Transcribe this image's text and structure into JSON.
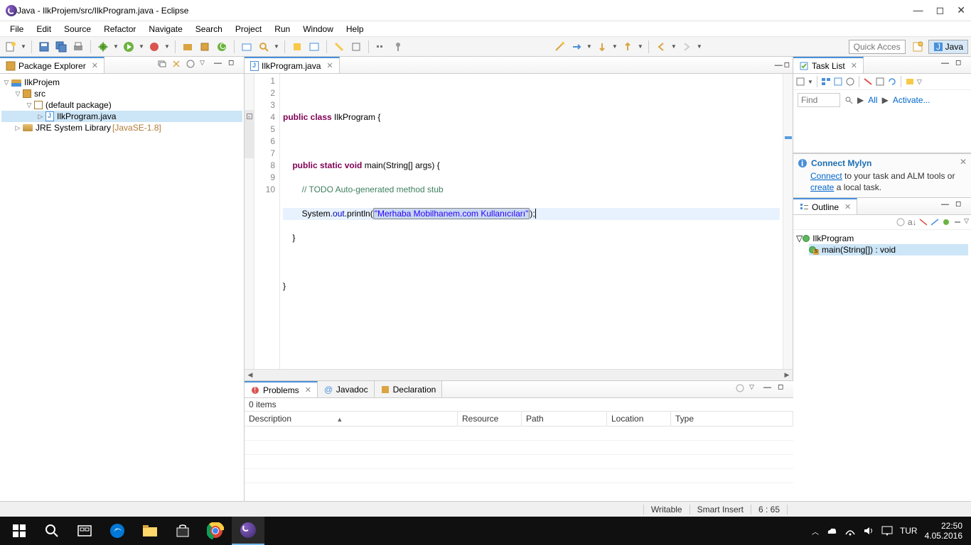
{
  "window": {
    "title": "Java - IlkProjem/src/IlkProgram.java - Eclipse"
  },
  "menu": [
    "File",
    "Edit",
    "Source",
    "Refactor",
    "Navigate",
    "Search",
    "Project",
    "Run",
    "Window",
    "Help"
  ],
  "quick_access": {
    "placeholder": "Quick Access"
  },
  "perspective": {
    "label": "Java"
  },
  "package_explorer": {
    "title": "Package Explorer",
    "project": "IlkProjem",
    "src": "src",
    "default_pkg": "(default package)",
    "file": "IlkProgram.java",
    "jre_label": "JRE System Library",
    "jre_version": "[JavaSE-1.8]"
  },
  "editor": {
    "tab": "IlkProgram.java",
    "lines": [
      "1",
      "2",
      "3",
      "4",
      "5",
      "6",
      "7",
      "8",
      "9",
      "10"
    ],
    "code": {
      "class_decl_pre": "public class ",
      "class_name": "IlkProgram",
      "method_pre": "public static void ",
      "method_name": "main",
      "method_args": "(String[] args) {",
      "comment": "// TODO Auto-generated method stub",
      "print_pre": "System.",
      "print_field": "out",
      "print_method": ".println(",
      "print_str": "\"Merhaba Mobilhanem.com Kullanıcıları\"",
      "print_end": ");"
    }
  },
  "problems": {
    "tabs": [
      "Problems",
      "Javadoc",
      "Declaration"
    ],
    "count": "0 items",
    "columns": [
      "Description",
      "Resource",
      "Path",
      "Location",
      "Type"
    ]
  },
  "task_list": {
    "title": "Task List",
    "find_label": "Find",
    "all_label": "All",
    "activate_label": "Activate..."
  },
  "mylyn": {
    "title": "Connect Mylyn",
    "link1": "Connect",
    "text1": " to your task and ALM tools or ",
    "link2": "create",
    "text2": " a local task."
  },
  "outline": {
    "title": "Outline",
    "class": "IlkProgram",
    "method": "main(String[]) : void"
  },
  "statusbar": {
    "writable": "Writable",
    "insert": "Smart Insert",
    "pos": "6 : 65"
  },
  "tray": {
    "lang": "TUR",
    "time": "22:50",
    "date": "4.05.2016"
  }
}
